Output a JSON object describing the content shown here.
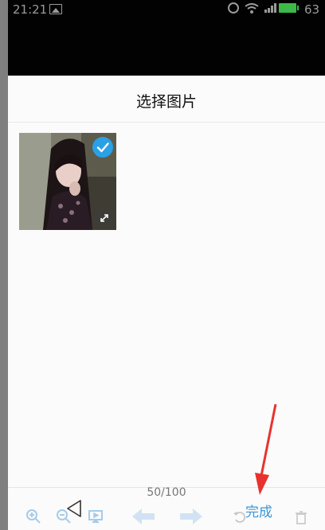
{
  "status_bar": {
    "time": "21:21",
    "battery_percent": "63",
    "icons": [
      "gallery-icon",
      "alarm-icon",
      "wifi-icon",
      "signal-icon",
      "battery-icon"
    ]
  },
  "header": {
    "title": "选择图片"
  },
  "grid": {
    "items": [
      {
        "selected": true,
        "icons": [
          "checkmark-icon",
          "expand-icon"
        ]
      }
    ]
  },
  "footer": {
    "counter": "50/100",
    "done_label": "完成"
  },
  "colors": {
    "accent": "#2aa0e6",
    "done_text": "#3c95d6",
    "annotation_arrow": "#e8322d"
  }
}
